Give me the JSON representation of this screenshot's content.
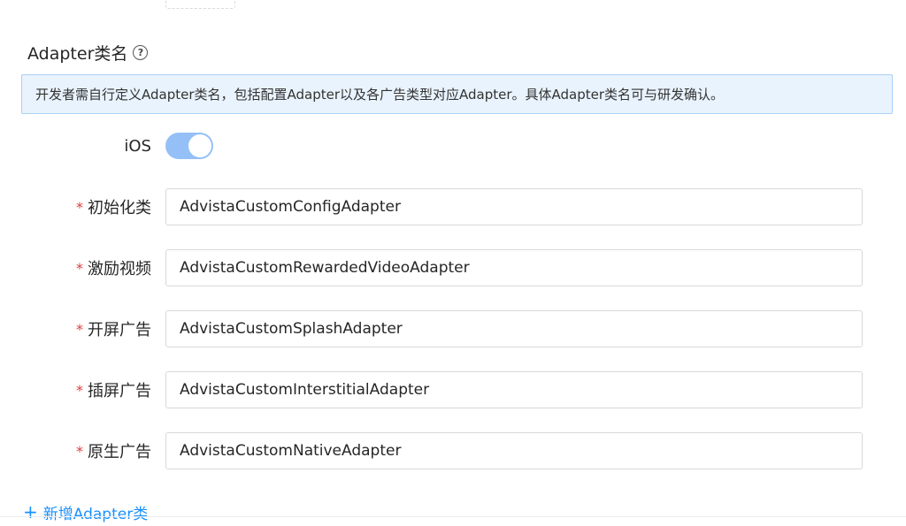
{
  "section": {
    "title": "Adapter类名",
    "help_icon": "question-circle-icon",
    "help_glyph": "?"
  },
  "info_banner": {
    "text": "开发者需自行定义Adapter类名，包括配置Adapter以及各广告类型对应Adapter。具体Adapter类名可与研发确认。"
  },
  "platform": {
    "label": "iOS",
    "enabled": true
  },
  "fields": [
    {
      "label": "初始化类",
      "required_mark": "*",
      "value": "AdvistaCustomConfigAdapter"
    },
    {
      "label": "激励视频",
      "required_mark": "*",
      "value": "AdvistaCustomRewardedVideoAdapter"
    },
    {
      "label": "开屏广告",
      "required_mark": "*",
      "value": "AdvistaCustomSplashAdapter"
    },
    {
      "label": "插屏广告",
      "required_mark": "*",
      "value": "AdvistaCustomInterstitialAdapter"
    },
    {
      "label": "原生广告",
      "required_mark": "*",
      "value": "AdvistaCustomNativeAdapter"
    }
  ],
  "add_button": {
    "icon": "plus-icon",
    "glyph": "+",
    "label": "新增Adapter类"
  },
  "colors": {
    "accent": "#1890ff",
    "toggle_on": "#94c0f7",
    "required": "#e23a3a",
    "banner_bg": "#e9f3fd",
    "banner_border": "#a9d1f6"
  }
}
